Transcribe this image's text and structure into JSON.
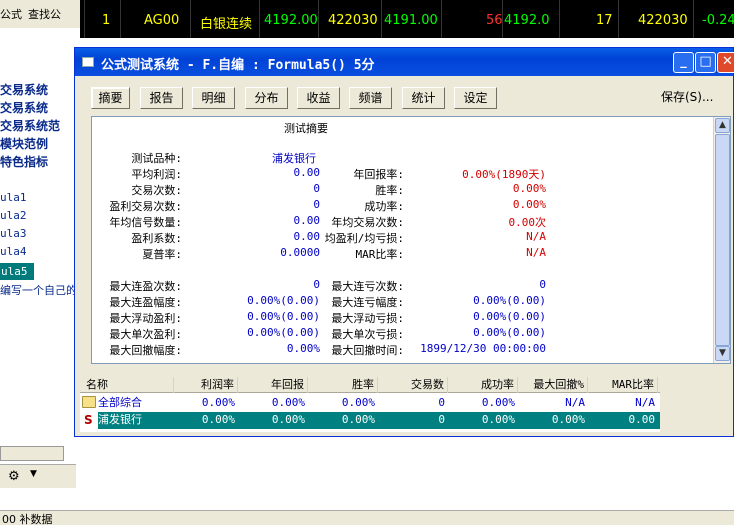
{
  "bg": {
    "menu": [
      "公式",
      "查找公"
    ],
    "quote": {
      "rownum": "1",
      "code": "AG00",
      "name": "白银连续",
      "v1": "4192.00",
      "v2": "422030",
      "v3": "4191.00",
      "v4": "56",
      "v5": "4192.0",
      "v6": "17",
      "v7": "422030",
      "v8": "-0.24"
    },
    "left_items": [
      "交易系统",
      "交易系统",
      "交易系统范",
      "模块范例",
      "特色指标"
    ],
    "formula_items": [
      "ula1",
      "ula2",
      "ula3",
      "ula4"
    ],
    "formula_selected": "ula5",
    "left_link": "编写一个自己的",
    "status": "00 补数据"
  },
  "dialog": {
    "title": "公式测试系统 - F.自编 : Formula5() 5分",
    "tabs": [
      "摘要",
      "报告",
      "明细",
      "分布",
      "收益",
      "频谱",
      "统计",
      "设定"
    ],
    "save_label": "保存(S)..."
  },
  "summary": {
    "heading": "测试摘要",
    "rows": [
      {
        "label": "测试品种:",
        "value": "浦发银行",
        "label2": "",
        "value2": ""
      },
      {
        "label": "平均利润:",
        "value": "0.00",
        "label2": "年回报率:",
        "value2": "0.00%(1890天)"
      },
      {
        "label": "交易次数:",
        "value": "0",
        "label2": "胜率:",
        "value2": "0.00%"
      },
      {
        "label": "盈利交易次数:",
        "value": "0",
        "label2": "成功率:",
        "value2": "0.00%"
      },
      {
        "label": "年均信号数量:",
        "value": "0.00",
        "label2": "年均交易次数:",
        "value2": "0.00次"
      },
      {
        "label": "盈利系数:",
        "value": "0.00",
        "label2": "均盈利/均亏损:",
        "value2": "N/A"
      },
      {
        "label": "夏普率:",
        "value": "0.0000",
        "label2": "MAR比率:",
        "value2": "N/A"
      }
    ],
    "rows2": [
      {
        "label": "最大连盈次数:",
        "value": "0",
        "label2": "最大连亏次数:",
        "value2": "0"
      },
      {
        "label": "最大连盈幅度:",
        "value": "0.00%(0.00)",
        "label2": "最大连亏幅度:",
        "value2": "0.00%(0.00)"
      },
      {
        "label": "最大浮动盈利:",
        "value": "0.00%(0.00)",
        "label2": "最大浮动亏损:",
        "value2": "0.00%(0.00)"
      },
      {
        "label": "最大单次盈利:",
        "value": "0.00%(0.00)",
        "label2": "最大单次亏损:",
        "value2": "0.00%(0.00)"
      },
      {
        "label": "最大回撤幅度:",
        "value": "0.00%",
        "label2": "最大回撤时间:",
        "value2": "1899/12/30 00:00:00"
      }
    ]
  },
  "table": {
    "headers": [
      "名称",
      "利润率",
      "年回报",
      "胜率",
      "交易数",
      "成功率",
      "最大回撤%",
      "MAR比率"
    ],
    "rows": [
      [
        "全部综合",
        "0.00%",
        "0.00%",
        "0.00%",
        "0",
        "0.00%",
        "N/A",
        "N/A"
      ],
      [
        "浦发银行",
        "0.00%",
        "0.00%",
        "0.00%",
        "0",
        "0.00%",
        "0.00%",
        "0.00"
      ]
    ]
  }
}
